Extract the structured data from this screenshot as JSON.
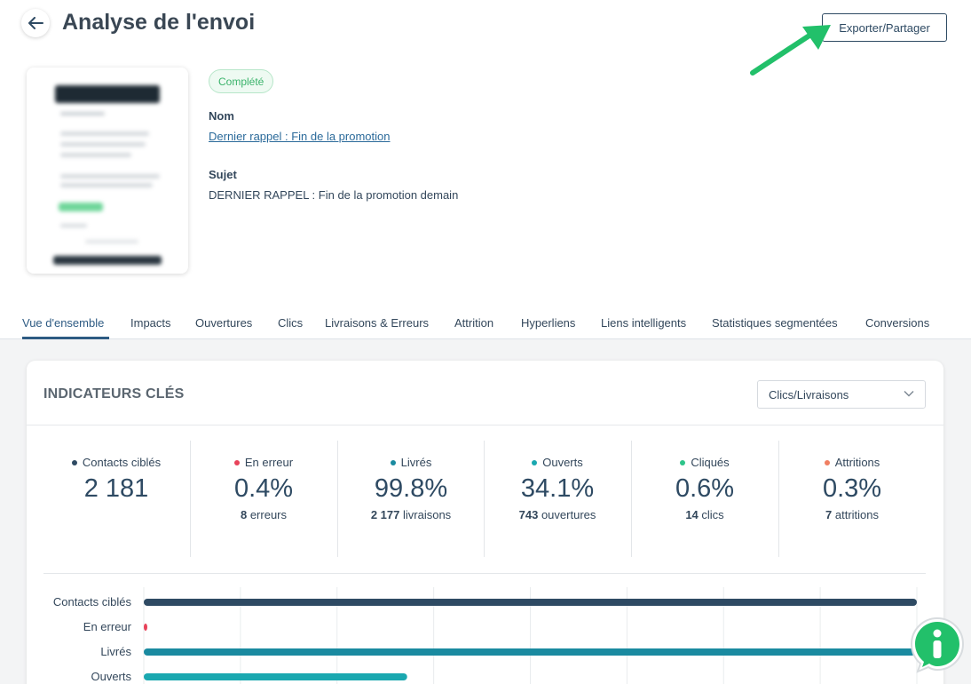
{
  "header": {
    "title": "Analyse de l'envoi",
    "export_label": "Exporter/Partager"
  },
  "info": {
    "status": "Complété",
    "name_label": "Nom",
    "name_value": "Dernier rappel : Fin de la promotion",
    "subject_label": "Sujet",
    "subject_value": "DERNIER RAPPEL : Fin de la promotion demain"
  },
  "tabs": [
    {
      "label": "Vue d'ensemble",
      "active": true
    },
    {
      "label": "Impacts"
    },
    {
      "label": "Ouvertures"
    },
    {
      "label": "Clics"
    },
    {
      "label": "Livraisons & Erreurs"
    },
    {
      "label": "Attrition"
    },
    {
      "label": "Hyperliens"
    },
    {
      "label": "Liens intelligents"
    },
    {
      "label": "Statistiques segmentées"
    },
    {
      "label": "Conversions"
    }
  ],
  "kpi": {
    "title": "INDICATEURS CLÉS",
    "select_value": "Clics/Livraisons",
    "metrics": [
      {
        "label": "Contacts ciblés",
        "value": "2 181",
        "sub_count": "",
        "sub_text": "",
        "color": "#2e4a63"
      },
      {
        "label": "En erreur",
        "value": "0.4%",
        "sub_count": "8",
        "sub_text": "erreurs",
        "color": "#e8435a"
      },
      {
        "label": "Livrés",
        "value": "99.8%",
        "sub_count": "2 177",
        "sub_text": "livraisons",
        "color": "#1a8aa0"
      },
      {
        "label": "Ouverts",
        "value": "34.1%",
        "sub_count": "743",
        "sub_text": "ouvertures",
        "color": "#1aa8b0"
      },
      {
        "label": "Cliqués",
        "value": "0.6%",
        "sub_count": "14",
        "sub_text": "clics",
        "color": "#2ec48a"
      },
      {
        "label": "Attritions",
        "value": "0.3%",
        "sub_count": "7",
        "sub_text": "attritions",
        "color": "#f07f62"
      }
    ]
  },
  "chart_data": {
    "type": "bar",
    "orientation": "horizontal",
    "categories": [
      "Contacts ciblés",
      "En erreur",
      "Livrés",
      "Ouverts"
    ],
    "values": [
      2181,
      8,
      2177,
      743
    ],
    "colors": [
      "#2e4a63",
      "#e8435a",
      "#1a8aa0",
      "#1aa8b0"
    ],
    "xlim": [
      0,
      2181
    ],
    "grid": true
  }
}
